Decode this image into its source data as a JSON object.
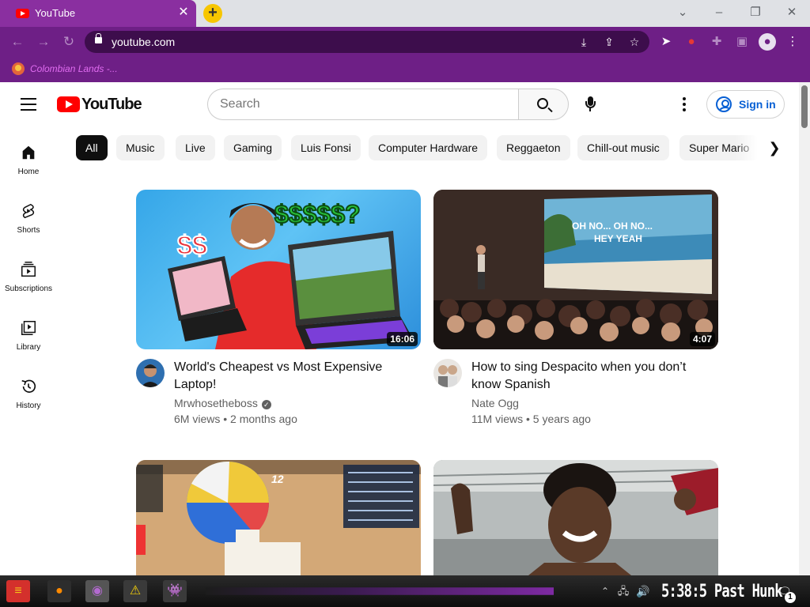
{
  "browser": {
    "tab_title": "YouTube",
    "url": "youtube.com",
    "bookmark_label": "Colombian Lands -..."
  },
  "header": {
    "logo_text": "YouTube",
    "search_placeholder": "Search",
    "signin_label": "Sign in"
  },
  "sidebar": {
    "items": [
      {
        "label": "Home",
        "icon": "home-icon"
      },
      {
        "label": "Shorts",
        "icon": "shorts-icon"
      },
      {
        "label": "Subscriptions",
        "icon": "subscriptions-icon"
      },
      {
        "label": "Library",
        "icon": "library-icon"
      },
      {
        "label": "History",
        "icon": "history-icon"
      }
    ]
  },
  "chips": [
    "All",
    "Music",
    "Live",
    "Gaming",
    "Luis Fonsi",
    "Computer Hardware",
    "Reggaeton",
    "Chill-out music",
    "Super Mario"
  ],
  "videos": [
    {
      "title": "World's Cheapest vs Most Expensive Laptop!",
      "channel": "Mrwhosetheboss",
      "verified": true,
      "views": "6M views",
      "age": "2 months ago",
      "duration": "16:06",
      "thumb_text": [
        "$$",
        "$$$$$?"
      ]
    },
    {
      "title": "How to sing Despacito when you don’t know Spanish",
      "channel": "Nate Ogg",
      "verified": false,
      "views": "11M views",
      "age": "5 years ago",
      "duration": "4:07",
      "thumb_text": [
        "OH NO... OH NO...",
        "HEY YEAH"
      ]
    },
    {
      "title": "",
      "channel": "",
      "duration": "",
      "thumb_text": [
        "12"
      ]
    },
    {
      "title": "",
      "channel": "",
      "duration": ""
    }
  ],
  "taskbar": {
    "clock": "5:38:5 Past Hunk",
    "notification_count": "1"
  },
  "colors": {
    "chrome_purple": "#6e1f86",
    "yt_red": "#ff0000",
    "signin_blue": "#065fd4"
  }
}
